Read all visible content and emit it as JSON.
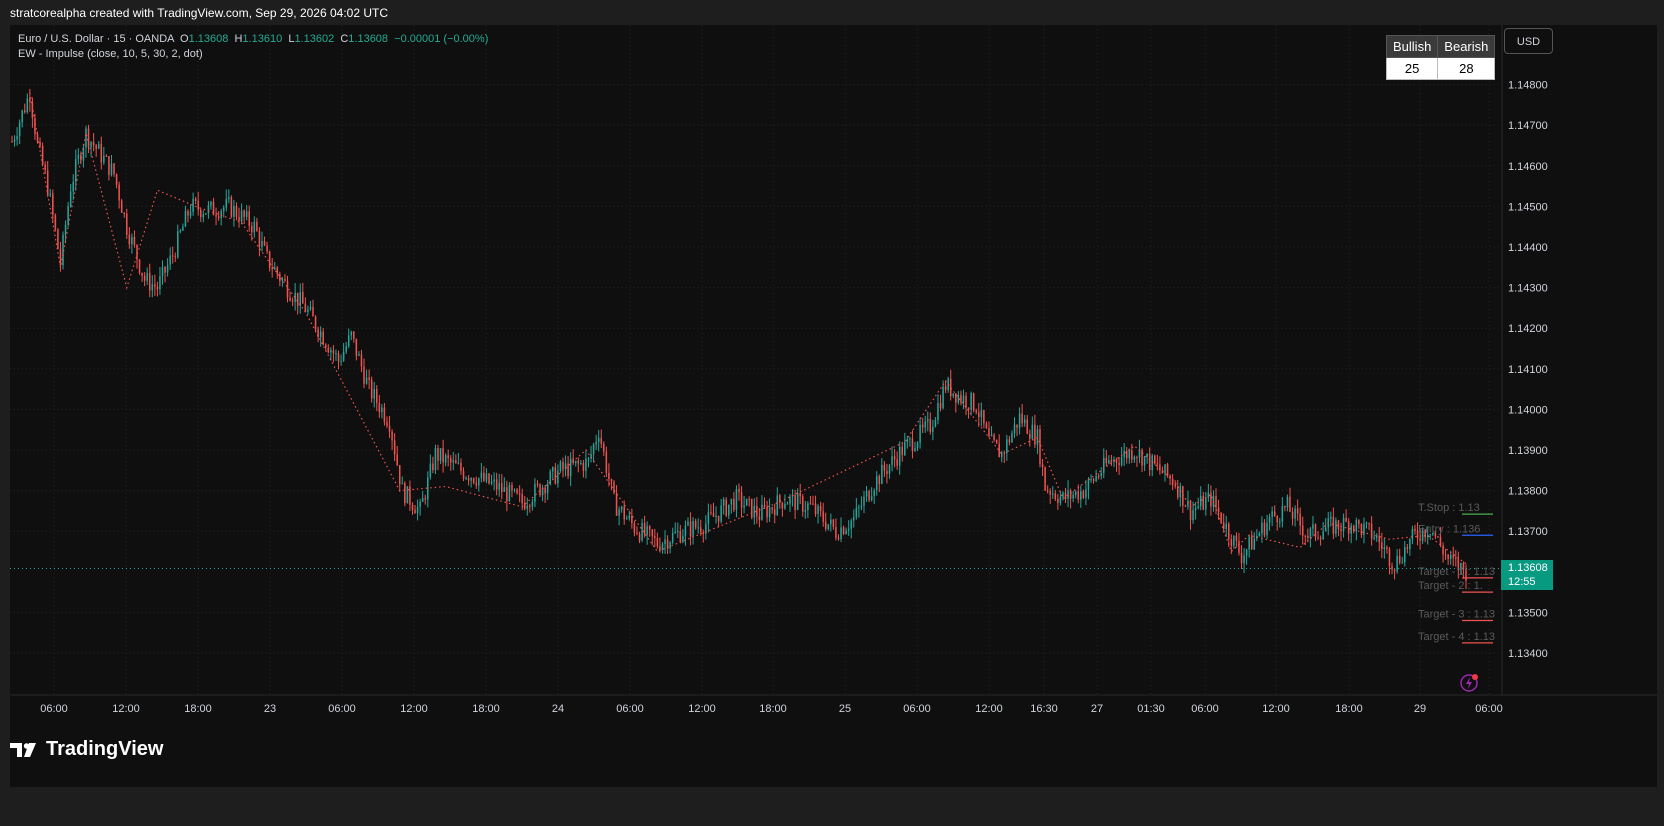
{
  "snapshot_header": "stratcorealpha created with TradingView.com, Sep 29, 2026 04:02 UTC",
  "legend": {
    "symbol": "Euro / U.S. Dollar · 15 · OANDA",
    "o_label": "O",
    "o_value": "1.13608",
    "h_label": "H",
    "h_value": "1.13610",
    "l_label": "L",
    "l_value": "1.13602",
    "c_label": "C",
    "c_value": "1.13608",
    "change": "−0.00001 (−0.00%)",
    "indicator": "EW - Impulse (close, 10, 5, 30, 2, dot)"
  },
  "ew_table": {
    "bullish_label": "Bullish",
    "bearish_label": "Bearish",
    "bullish_value": "25",
    "bearish_value": "28"
  },
  "currency_button": "USD",
  "price_tag": {
    "price": "1.13608",
    "countdown": "12:55"
  },
  "logo_text": "TradingView",
  "colors": {
    "background": "#0f0f0f",
    "up": "#26a69a",
    "down": "#ef5350",
    "grid": "#262626",
    "text": "#d1d4dc",
    "price_tag": "#089981",
    "zigzag": "#ef5350",
    "tstop": "#4caf50",
    "entry": "#2962ff",
    "target": "#ef5350"
  },
  "chart_data": {
    "type": "candlestick",
    "symbol": "EURUSD",
    "interval": "15",
    "ylim": [
      1.1331,
      1.1483
    ],
    "y_ticks": [
      "1.14800",
      "1.14700",
      "1.14600",
      "1.14500",
      "1.14400",
      "1.14300",
      "1.14200",
      "1.14100",
      "1.14000",
      "1.13900",
      "1.13800",
      "1.13700",
      "1.13500",
      "1.13400"
    ],
    "x_ticks": [
      "06:00",
      "12:00",
      "18:00",
      "23",
      "06:00",
      "12:00",
      "18:00",
      "24",
      "06:00",
      "12:00",
      "18:00",
      "25",
      "06:00",
      "12:00",
      "16:30",
      "27",
      "01:30",
      "06:00",
      "12:00",
      "18:00",
      "29",
      "06:00"
    ],
    "price_path": [
      [
        0,
        1.1466
      ],
      [
        7,
        1.1478
      ],
      [
        10,
        1.1465
      ],
      [
        14,
        1.1455
      ],
      [
        19,
        1.1436
      ],
      [
        23,
        1.1455
      ],
      [
        29,
        1.1468
      ],
      [
        40,
        1.1458
      ],
      [
        45,
        1.1445
      ],
      [
        52,
        1.1432
      ],
      [
        57,
        1.143
      ],
      [
        63,
        1.1438
      ],
      [
        70,
        1.145
      ],
      [
        77,
        1.1449
      ],
      [
        85,
        1.145
      ],
      [
        95,
        1.1445
      ],
      [
        100,
        1.1437
      ],
      [
        108,
        1.143
      ],
      [
        115,
        1.1425
      ],
      [
        120,
        1.142
      ],
      [
        128,
        1.1412
      ],
      [
        133,
        1.1418
      ],
      [
        140,
        1.1405
      ],
      [
        148,
        1.1397
      ],
      [
        153,
        1.138
      ],
      [
        160,
        1.1375
      ],
      [
        166,
        1.1389
      ],
      [
        176,
        1.1385
      ],
      [
        190,
        1.1381
      ],
      [
        200,
        1.1377
      ],
      [
        215,
        1.1385
      ],
      [
        226,
        1.1387
      ],
      [
        230,
        1.1395
      ],
      [
        236,
        1.1377
      ],
      [
        244,
        1.1371
      ],
      [
        253,
        1.1367
      ],
      [
        263,
        1.137
      ],
      [
        272,
        1.1372
      ],
      [
        284,
        1.1378
      ],
      [
        293,
        1.1374
      ],
      [
        303,
        1.1378
      ],
      [
        313,
        1.1376
      ],
      [
        323,
        1.137
      ],
      [
        330,
        1.1373
      ],
      [
        338,
        1.1382
      ],
      [
        349,
        1.139
      ],
      [
        360,
        1.1396
      ],
      [
        366,
        1.1406
      ],
      [
        372,
        1.1403
      ],
      [
        378,
        1.1401
      ],
      [
        383,
        1.1392
      ],
      [
        388,
        1.1389
      ],
      [
        395,
        1.1398
      ],
      [
        402,
        1.1393
      ],
      [
        405,
        1.1381
      ],
      [
        412,
        1.1378
      ],
      [
        420,
        1.138
      ],
      [
        430,
        1.1387
      ],
      [
        440,
        1.139
      ],
      [
        448,
        1.1386
      ],
      [
        456,
        1.1382
      ],
      [
        462,
        1.1375
      ],
      [
        470,
        1.1378
      ],
      [
        482,
        1.1364
      ],
      [
        487,
        1.1368
      ],
      [
        493,
        1.1373
      ],
      [
        500,
        1.1376
      ],
      [
        508,
        1.1369
      ],
      [
        516,
        1.1371
      ],
      [
        525,
        1.1372
      ],
      [
        534,
        1.1369
      ],
      [
        542,
        1.1362
      ],
      [
        550,
        1.1369
      ],
      [
        556,
        1.1371
      ],
      [
        563,
        1.1363
      ],
      [
        570,
        1.136
      ]
    ],
    "zigzag": [
      [
        7,
        1.1478
      ],
      [
        19,
        1.1435
      ],
      [
        29,
        1.1468
      ],
      [
        45,
        1.143
      ],
      [
        57,
        1.1454
      ],
      [
        72,
        1.145
      ],
      [
        90,
        1.1446
      ],
      [
        100,
        1.1437
      ],
      [
        115,
        1.1424
      ],
      [
        152,
        1.138
      ],
      [
        170,
        1.1381
      ],
      [
        200,
        1.1376
      ],
      [
        225,
        1.139
      ],
      [
        253,
        1.1365
      ],
      [
        300,
        1.1377
      ],
      [
        350,
        1.1392
      ],
      [
        366,
        1.1407
      ],
      [
        388,
        1.1389
      ],
      [
        402,
        1.1393
      ],
      [
        412,
        1.1378
      ],
      [
        440,
        1.1391
      ],
      [
        456,
        1.1382
      ],
      [
        462,
        1.1376
      ],
      [
        470,
        1.1379
      ],
      [
        478,
        1.1365
      ],
      [
        485,
        1.1369
      ],
      [
        505,
        1.1366
      ],
      [
        516,
        1.1372
      ],
      [
        540,
        1.1368
      ],
      [
        555,
        1.1369
      ],
      [
        570,
        1.1362
      ]
    ],
    "last_price": 1.13608,
    "levels": [
      {
        "label": "T.Stop : 1.13",
        "value": 1.13742,
        "color": "tstop"
      },
      {
        "label": "Entry : 1.136",
        "value": 1.1369,
        "color": "entry"
      },
      {
        "label": "Target - 1 : 1.13",
        "value": 1.13585,
        "color": "target"
      },
      {
        "label": "Target - 2 : 1.",
        "value": 1.1355,
        "color": "target"
      },
      {
        "label": "Target - 3 : 1.13",
        "value": 1.1348,
        "color": "target"
      },
      {
        "label": "Target - 4 : 1.13",
        "value": 1.13425,
        "color": "target"
      }
    ]
  }
}
